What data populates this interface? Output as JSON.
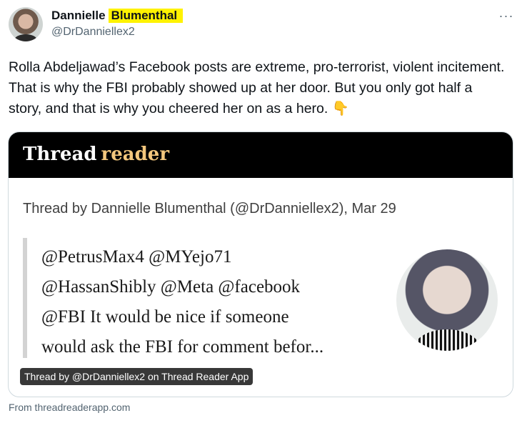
{
  "tweet": {
    "author_first": "Dannielle",
    "author_last": "Blumenthal",
    "handle": "@DrDanniellex2",
    "text": "Rolla Abdeljawad’s Facebook posts are extreme, pro-terrorist, violent incitement. That is why the FBI probably showed up at her door. But you only got half a story, and that is why you cheered her on as a hero. 👇",
    "more_icon": "···"
  },
  "card": {
    "brand_word1": "Thread",
    "brand_word2": "reader",
    "subtitle": "Thread by Dannielle Blumenthal (@DrDanniellex2), Mar 29",
    "quote_lines": [
      "@PetrusMax4 @MYejo71",
      "@HassanShibly @Meta @facebook",
      "@FBI It would be nice if someone",
      "would ask the FBI for comment befor..."
    ],
    "caption": "Thread by @DrDanniellex2 on Thread Reader App"
  },
  "source": "From threadreaderapp.com",
  "colors": {
    "highlight": "#fff200",
    "brand_accent": "#f3c77d",
    "secondary_text": "#536471"
  }
}
